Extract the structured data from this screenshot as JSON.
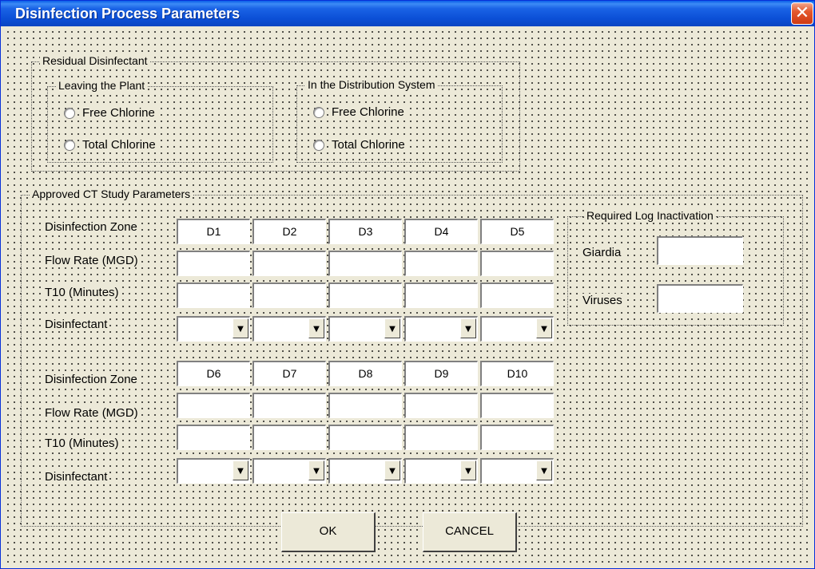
{
  "window": {
    "title": "Disinfection Process Parameters",
    "close_symbol": "✕"
  },
  "residual": {
    "title": "Residual Disinfectant",
    "leaving": {
      "title": "Leaving the Plant",
      "options": [
        "Free Chlorine",
        "Total Chlorine"
      ]
    },
    "distribution": {
      "title": "In the Distribution System",
      "options": [
        "Free Chlorine",
        "Total Chlorine"
      ]
    }
  },
  "ct": {
    "title": "Approved CT Study Parameters",
    "row_labels": [
      "Disinfection Zone",
      "Flow Rate (MGD)",
      "T10 (Minutes)",
      "Disinfectant"
    ],
    "zones_top": [
      "D1",
      "D2",
      "D3",
      "D4",
      "D5"
    ],
    "zones_bottom": [
      "D6",
      "D7",
      "D8",
      "D9",
      "D10"
    ],
    "dropdown_arrow": "▼"
  },
  "log": {
    "title": "Required Log Inactivation",
    "giardia": "Giardia",
    "viruses": "Viruses"
  },
  "buttons": {
    "ok": "OK",
    "cancel": "CANCEL"
  }
}
